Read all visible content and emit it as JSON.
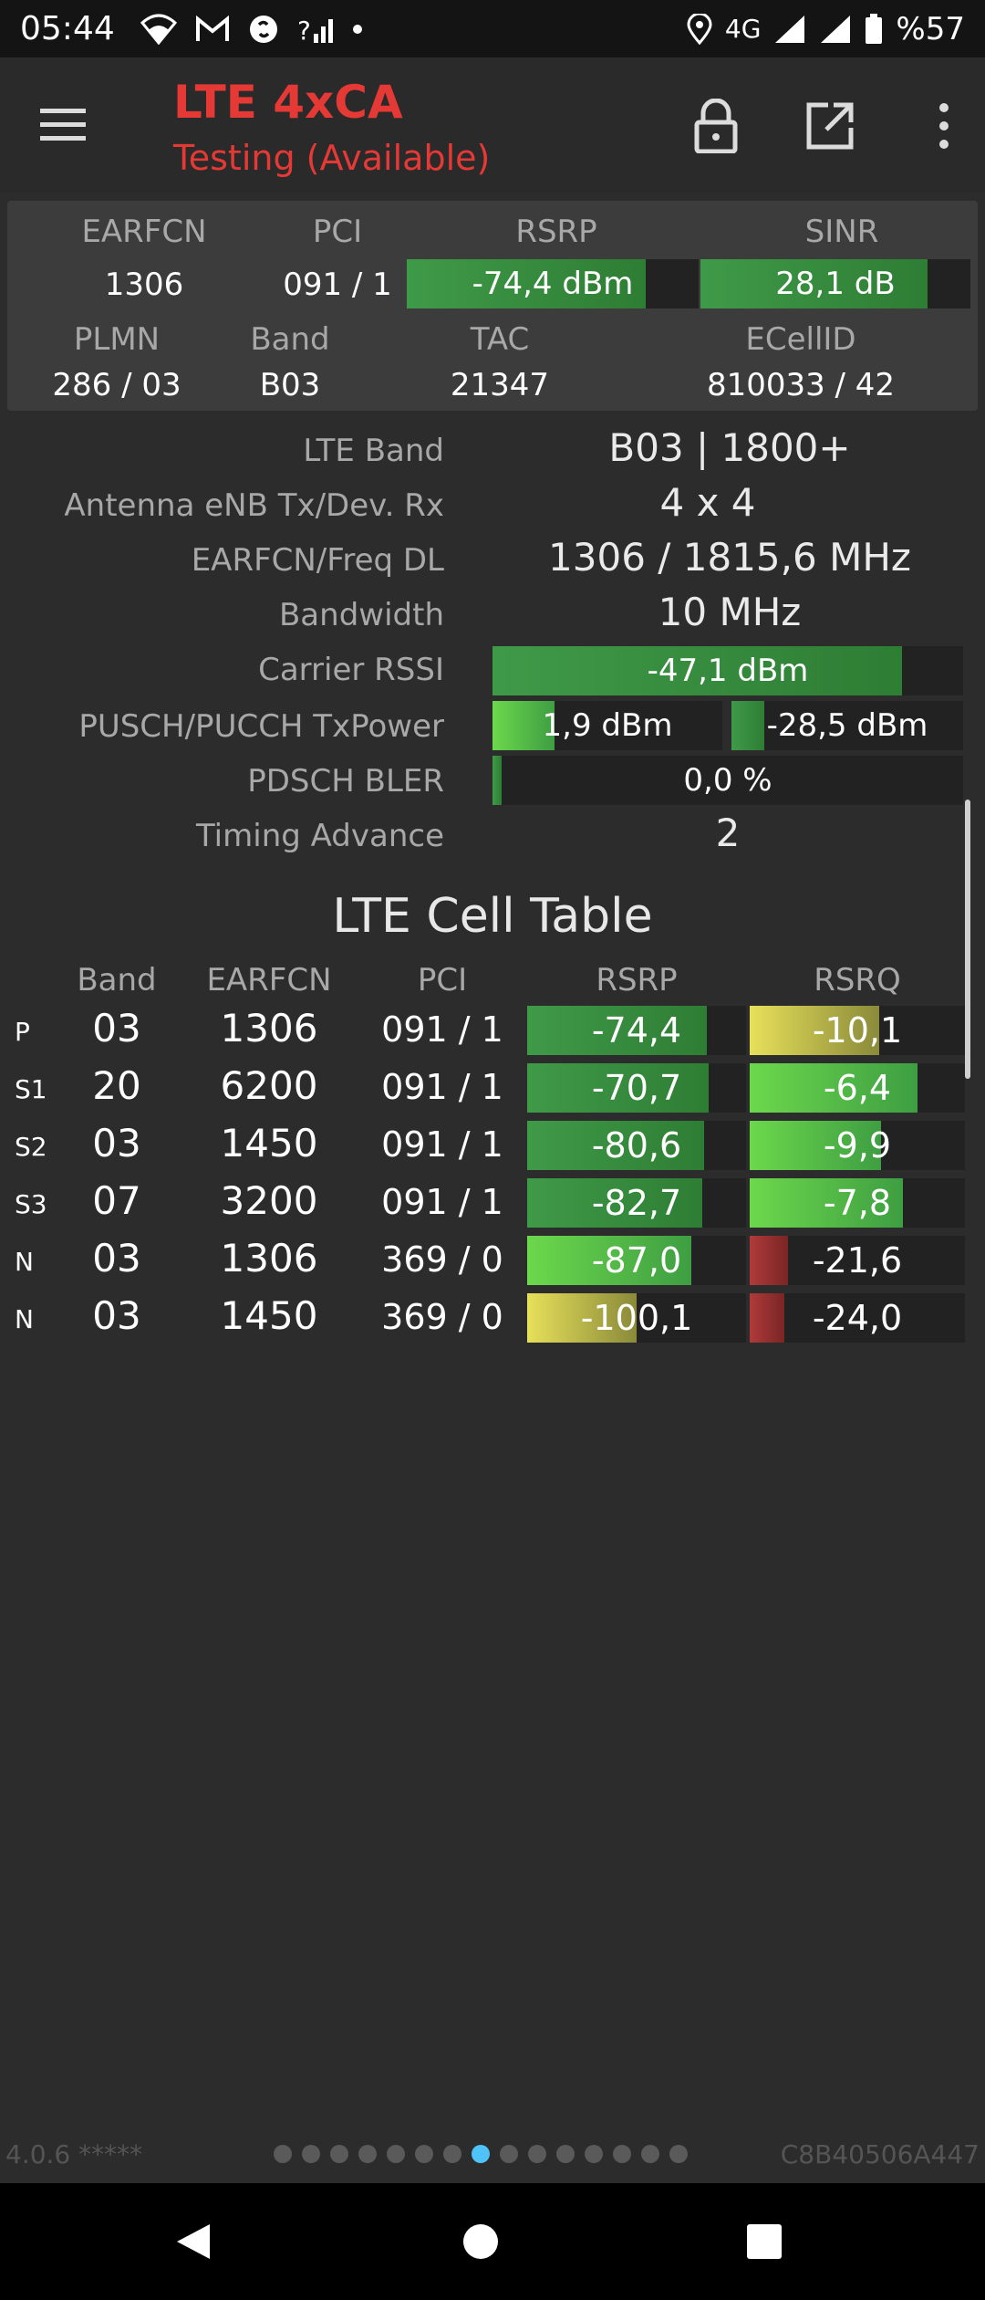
{
  "status_bar": {
    "time": "05:44",
    "network_label": "4G",
    "battery": "%57",
    "icons_left": [
      "wifi-icon",
      "gmail-icon",
      "shazam-icon",
      "signal-question-icon",
      "dot-icon"
    ],
    "icons_right": [
      "location-icon",
      "signal-icon",
      "signal-icon",
      "battery-icon"
    ]
  },
  "app_bar": {
    "title": "LTE 4xCA",
    "subtitle": "Testing (Available)",
    "icons": [
      "menu-icon",
      "lock-icon",
      "open-external-icon",
      "more-vert-icon"
    ],
    "accent_color": "#e53935"
  },
  "summary": {
    "headers": {
      "earfcn": "EARFCN",
      "pci": "PCI",
      "rsrp": "RSRP",
      "sinr": "SINR",
      "plmn": "PLMN",
      "band": "Band",
      "tac": "TAC",
      "ecellid": "ECellID"
    },
    "earfcn": "1306",
    "pci": "091 / 1",
    "rsrp": {
      "text": "-74,4 dBm",
      "fill": 0.82
    },
    "sinr": {
      "text": "28,1 dB",
      "fill": 0.84
    },
    "plmn": "286 / 03",
    "band": "B03",
    "tac": "21347",
    "ecellid": "810033 / 42"
  },
  "details": {
    "lte_band": {
      "label": "LTE Band",
      "value": "B03 | 1800+"
    },
    "antenna": {
      "label": "Antenna eNB Tx/Dev. Rx",
      "value": "4 x 4"
    },
    "earfcn_freq": {
      "label": "EARFCN/Freq DL",
      "value": "1306 / 1815,6 MHz"
    },
    "bandwidth": {
      "label": "Bandwidth",
      "value": "10 MHz"
    },
    "carrier_rssi": {
      "label": "Carrier RSSI",
      "text": "-47,1 dBm",
      "fill": 0.87
    },
    "txpower": {
      "label": "PUSCH/PUCCH TxPower",
      "pusch": {
        "text": "1,9 dBm",
        "fill": 0.27
      },
      "pucch": {
        "text": "-28,5 dBm",
        "fill": 0.14
      }
    },
    "bler": {
      "label": "PDSCH BLER",
      "text": "0,0 %",
      "fill": 0.02
    },
    "timing_advance": {
      "label": "Timing Advance",
      "value": "2"
    }
  },
  "cell_table": {
    "title": "LTE Cell Table",
    "headers": {
      "band": "Band",
      "earfcn": "EARFCN",
      "pci": "PCI",
      "rsrp": "RSRP",
      "rsrq": "RSRQ"
    },
    "rows": [
      {
        "type": "P",
        "band": "03",
        "earfcn": "1306",
        "pci": "091 / 1",
        "rsrp": "-74,4",
        "rsrp_fill": 0.82,
        "rsrp_color": "green",
        "rsrq": "-10,1",
        "rsrq_fill": 0.6,
        "rsrq_color": "yellow"
      },
      {
        "type": "S1",
        "band": "20",
        "earfcn": "6200",
        "pci": "091 / 1",
        "rsrp": "-70,7",
        "rsrp_fill": 0.83,
        "rsrp_color": "green",
        "rsrq": "-6,4",
        "rsrq_fill": 0.78,
        "rsrq_color": "bright"
      },
      {
        "type": "S2",
        "band": "03",
        "earfcn": "1450",
        "pci": "091 / 1",
        "rsrp": "-80,6",
        "rsrp_fill": 0.81,
        "rsrp_color": "green",
        "rsrq": "-9,9",
        "rsrq_fill": 0.61,
        "rsrq_color": "bright"
      },
      {
        "type": "S3",
        "band": "07",
        "earfcn": "3200",
        "pci": "091 / 1",
        "rsrp": "-82,7",
        "rsrp_fill": 0.8,
        "rsrp_color": "green",
        "rsrq": "-7,8",
        "rsrq_fill": 0.71,
        "rsrq_color": "bright"
      },
      {
        "type": "N",
        "band": "03",
        "earfcn": "1306",
        "pci": "369 / 0",
        "rsrp": "-87,0",
        "rsrp_fill": 0.75,
        "rsrp_color": "bright",
        "rsrq": "-21,6",
        "rsrq_fill": 0.18,
        "rsrq_color": "red"
      },
      {
        "type": "N",
        "band": "03",
        "earfcn": "1450",
        "pci": "369 / 0",
        "rsrp": "-100,1",
        "rsrp_fill": 0.5,
        "rsrp_color": "yellow",
        "rsrq": "-24,0",
        "rsrq_fill": 0.16,
        "rsrq_color": "red"
      }
    ]
  },
  "footer": {
    "version": "4.0.6 *****",
    "device_id": "C8B40506A447",
    "page_count": 15,
    "active_page": 7
  },
  "nav_bar": {
    "icons": [
      "back-icon",
      "home-icon",
      "recents-icon"
    ]
  }
}
